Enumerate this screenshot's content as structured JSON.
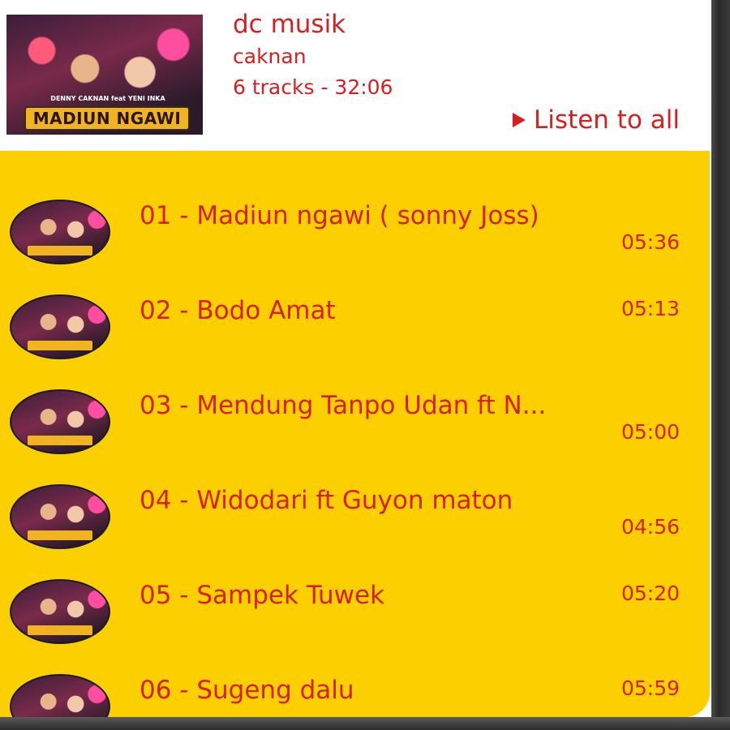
{
  "album": {
    "cover_title": "MADIUN NGAWI",
    "cover_artists": "DENNY CAKNAN feat YENI INKA",
    "name": "dc musik",
    "artist": "caknan",
    "meta": "6 tracks - 32:06",
    "listen_all_label": "Listen to all",
    "play_icon": "play-icon"
  },
  "tracks": [
    {
      "title": "01 - Madiun ngawi ( sonny Joss)",
      "duration": "05:36"
    },
    {
      "title": "02 - Bodo Amat",
      "duration": "05:13"
    },
    {
      "title": "03 - Mendung Tanpo Udan ft N...",
      "duration": "05:00"
    },
    {
      "title": "04 - Widodari ft Guyon maton",
      "duration": "04:56"
    },
    {
      "title": "05 - Sampek Tuwek",
      "duration": "05:20"
    },
    {
      "title": "06 - Sugeng dalu",
      "duration": "05:59"
    }
  ],
  "colors": {
    "accent": "#d81f1f",
    "list_background": "#fcd000",
    "header_background": "#ffffff"
  }
}
